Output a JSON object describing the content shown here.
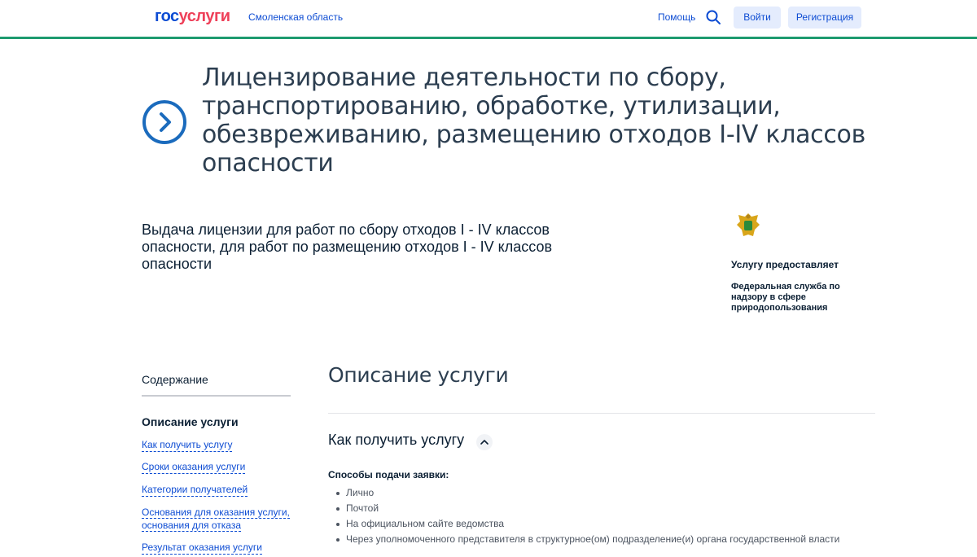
{
  "header": {
    "logo_part1": "гос",
    "logo_part2": "услуги",
    "region": "Смоленская область",
    "help": "Помощь",
    "login": "Войти",
    "register": "Регистрация"
  },
  "hero": {
    "title": "Лицензирование деятельности по сбору, транспортированию, обработке, утилизации, обезвреживанию, размещению отходов I-IV классов опасности",
    "subtitle": "Выдача лицензии для работ по сбору отходов I - IV классов опасности, для работ по размещению отходов I - IV классов опасности"
  },
  "provider": {
    "label": "Услугу предоставляет",
    "name": "Федеральная служба по надзору в сфере природопользования"
  },
  "toc": {
    "title": "Содержание",
    "section": "Описание услуги",
    "links": [
      "Как получить услугу",
      "Сроки оказания услуги",
      "Категории получателей",
      "Основания для оказания услуги, основания для отказа",
      "Результат оказания услуги"
    ]
  },
  "main": {
    "title": "Описание услуги",
    "how_title": "Как получить услугу",
    "methods_label": "Способы подачи заявки:",
    "methods": [
      "Лично",
      "Почтой",
      "На официальном сайте ведомства",
      "Через уполномоченного представителя в структурное(ом) подразделение(и) органа государственной власти"
    ]
  },
  "colors": {
    "brand_blue": "#0d4cd3",
    "brand_red": "#ee3f58",
    "header_rule": "#1d9b6f",
    "button_bg": "#e4ecfd"
  },
  "icons": {
    "search": "search-icon",
    "circle_arrow": "chevron-right-circle-icon",
    "emblem": "emblem-icon",
    "collapse": "chevron-up-icon"
  }
}
